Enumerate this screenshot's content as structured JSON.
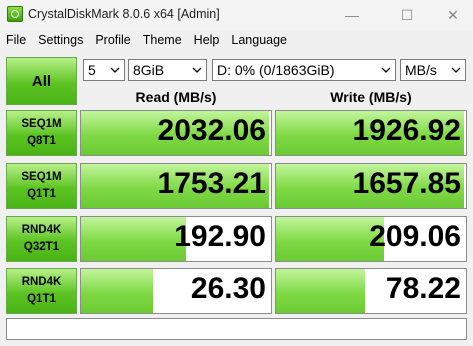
{
  "window": {
    "title": "CrystalDiskMark 8.0.6 x64 [Admin]",
    "controls": {
      "minimize": "—",
      "maximize": "☐",
      "close": "✕"
    }
  },
  "menu": [
    "File",
    "Settings",
    "Profile",
    "Theme",
    "Help",
    "Language"
  ],
  "toolbar": {
    "all_label": "All",
    "count": "5",
    "size": "8GiB",
    "drive": "D: 0% (0/1863GiB)",
    "unit": "MB/s"
  },
  "headers": {
    "read": "Read (MB/s)",
    "write": "Write (MB/s)"
  },
  "tests": [
    {
      "line1": "SEQ1M",
      "line2": "Q8T1",
      "read": "2032.06",
      "write": "1926.92",
      "read_fill": 0.99,
      "write_fill": 0.99
    },
    {
      "line1": "SEQ1M",
      "line2": "Q1T1",
      "read": "1753.21",
      "write": "1657.85",
      "read_fill": 0.99,
      "write_fill": 0.99
    },
    {
      "line1": "RND4K",
      "line2": "Q32T1",
      "read": "192.90",
      "write": "209.06",
      "read_fill": 0.55,
      "write_fill": 0.57
    },
    {
      "line1": "RND4K",
      "line2": "Q1T1",
      "read": "26.30",
      "write": "78.22",
      "read_fill": 0.38,
      "write_fill": 0.47
    }
  ],
  "status_text": ""
}
